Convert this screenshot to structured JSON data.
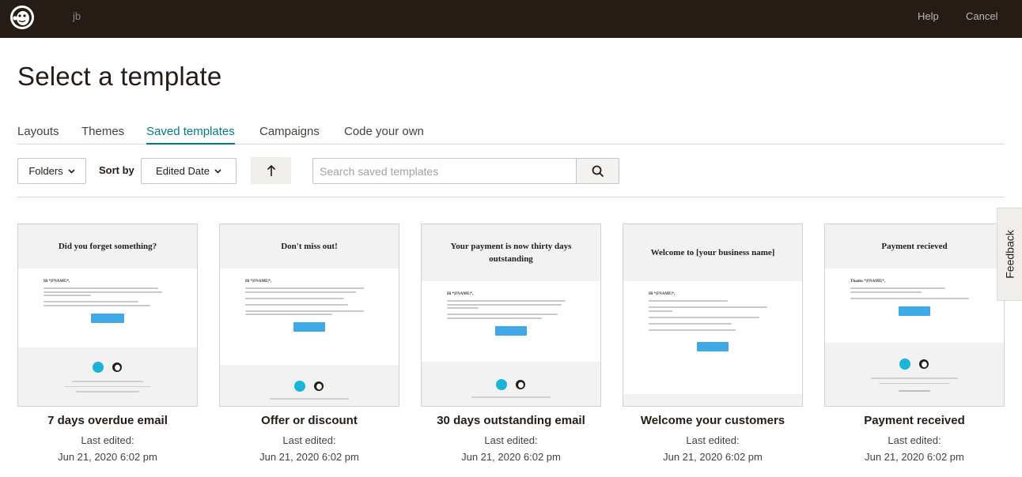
{
  "topbar": {
    "account": "jb",
    "help": "Help",
    "cancel": "Cancel"
  },
  "page_title": "Select a template",
  "tabs": [
    {
      "label": "Layouts",
      "active": false
    },
    {
      "label": "Themes",
      "active": false
    },
    {
      "label": "Saved templates",
      "active": true
    },
    {
      "label": "Campaigns",
      "active": false
    },
    {
      "label": "Code your own",
      "active": false
    }
  ],
  "toolbar": {
    "folders_label": "Folders",
    "sort_by_label": "Sort by",
    "sort_value": "Edited Date",
    "search_placeholder": "Search saved templates"
  },
  "templates": [
    {
      "preview_heading": "Did you forget something?",
      "name": "7 days overdue email",
      "edited_label": "Last edited:",
      "edited_date": "Jun 21, 2020 6:02 pm"
    },
    {
      "preview_heading": "Don't miss out!",
      "name": "Offer or discount",
      "edited_label": "Last edited:",
      "edited_date": "Jun 21, 2020 6:02 pm"
    },
    {
      "preview_heading": "Your payment is now thirty days outstanding",
      "name": "30 days outstanding email",
      "edited_label": "Last edited:",
      "edited_date": "Jun 21, 2020 6:02 pm"
    },
    {
      "preview_heading": "Welcome to [your business name]",
      "name": "Welcome your customers",
      "edited_label": "Last edited:",
      "edited_date": "Jun 21, 2020 6:02 pm"
    },
    {
      "preview_heading": "Payment recieved",
      "name": "Payment received",
      "edited_label": "Last edited:",
      "edited_date": "Jun 21, 2020 6:02 pm"
    }
  ],
  "feedback_label": "Feedback",
  "colors": {
    "topbar": "#241c15",
    "accent": "#007c89",
    "cta": "#3fa9e6"
  },
  "icons": [
    "mailchimp-logo-icon",
    "chevron-down-icon",
    "arrow-up-icon",
    "search-icon",
    "xero-icon"
  ]
}
